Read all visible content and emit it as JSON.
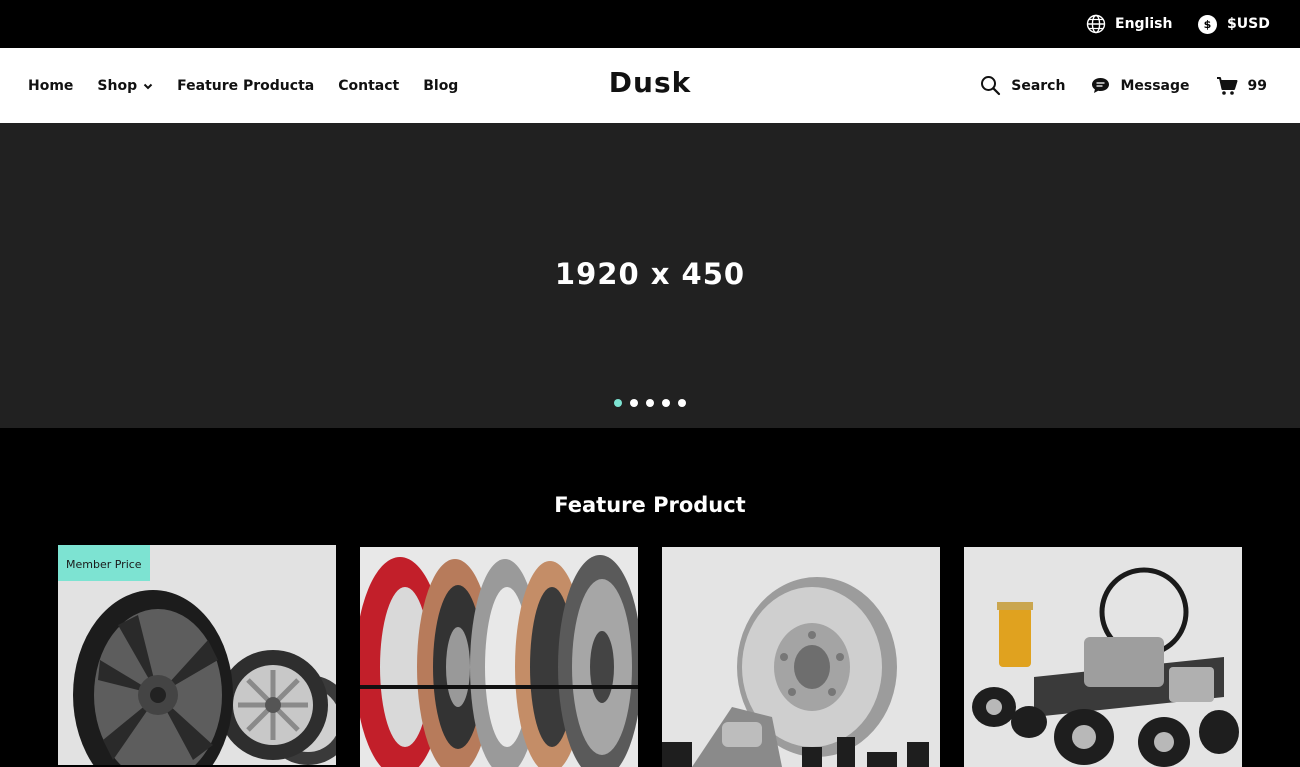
{
  "topbar": {
    "language": "English",
    "currency": "$USD",
    "currency_symbol": "$"
  },
  "nav": {
    "items": [
      "Home",
      "Shop",
      "Feature Producta",
      "Contact",
      "Blog"
    ],
    "brand": "Dusk",
    "search_label": "Search",
    "message_label": "Message",
    "cart_count": "99"
  },
  "hero": {
    "size_text": "1920 x 450",
    "slide_count": 5,
    "active_slide": 1,
    "active_dot_color": "#7de3d2"
  },
  "featured": {
    "title": "Feature Product",
    "badge": "Member Price",
    "products": [
      {
        "image": "alloy-wheels-image"
      },
      {
        "image": "clutch-kit-image"
      },
      {
        "image": "brake-disc-image"
      },
      {
        "image": "engine-parts-image"
      }
    ]
  },
  "colors": {
    "accent": "#7de3d2",
    "hero_bg": "#212121",
    "page_bg": "#000000"
  }
}
